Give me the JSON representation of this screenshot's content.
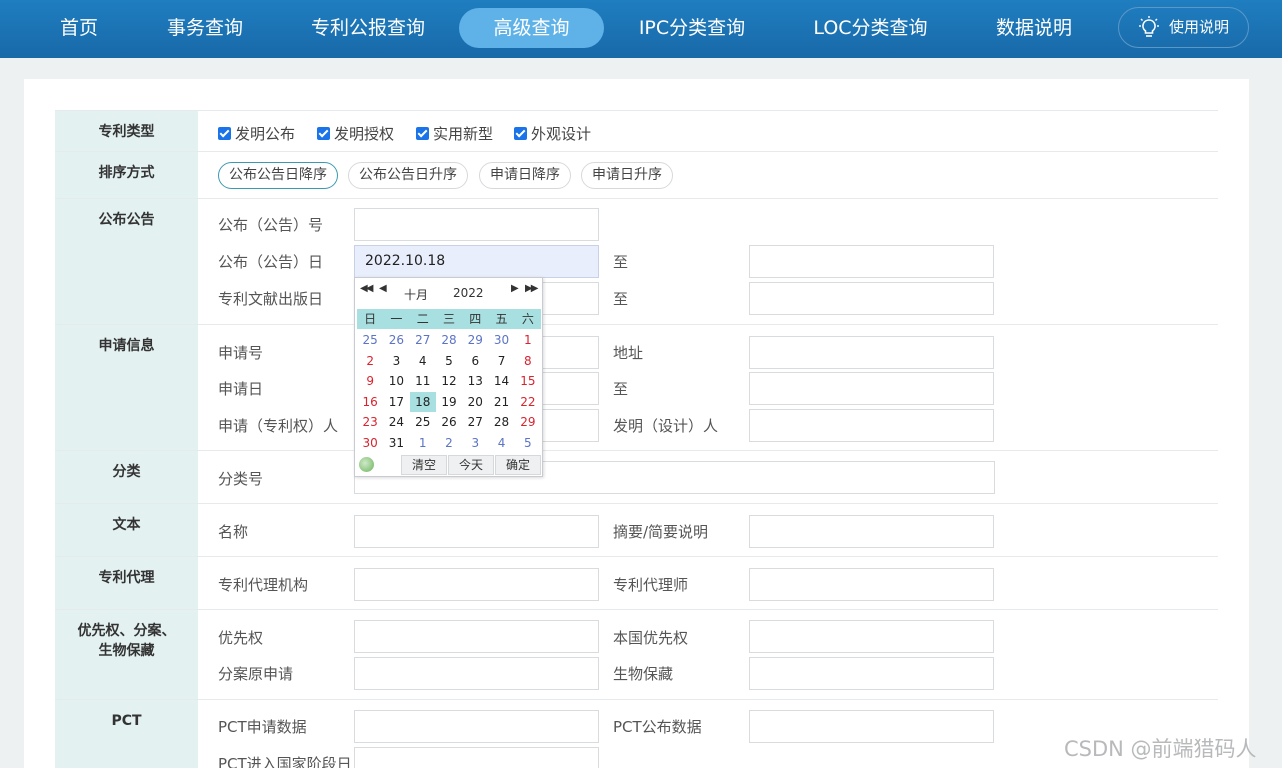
{
  "nav": {
    "items": [
      "首页",
      "事务查询",
      "专利公报查询",
      "高级查询",
      "IPC分类查询",
      "LOC分类查询",
      "数据说明"
    ],
    "active": "高级查询",
    "help": "使用说明"
  },
  "sections": {
    "type": {
      "label": "专利类型",
      "checkboxes": [
        "发明公布",
        "发明授权",
        "实用新型",
        "外观设计"
      ]
    },
    "sort": {
      "label": "排序方式",
      "options": [
        "公布公告日降序",
        "公布公告日升序",
        "申请日降序",
        "申请日升序"
      ],
      "selected": "公布公告日降序"
    },
    "publication": {
      "label": "公布公告",
      "pub_no": "公布（公告）号",
      "pub_date": "公布（公告）日",
      "pub_date_value": "2022.10.18",
      "to": "至",
      "doc_date": "专利文献出版日"
    },
    "application": {
      "label": "申请信息",
      "app_no": "申请号",
      "address": "地址",
      "app_date": "申请日",
      "to": "至",
      "applicant": "申请（专利权）人",
      "inventor": "发明（设计）人"
    },
    "classification": {
      "label": "分类",
      "class_no": "分类号"
    },
    "text": {
      "label": "文本",
      "name": "名称",
      "abstract": "摘要/简要说明"
    },
    "agency": {
      "label": "专利代理",
      "agency": "专利代理机构",
      "agent": "专利代理师"
    },
    "priority": {
      "label": "优先权、分案、生物保藏",
      "priority": "优先权",
      "domestic_priority": "本国优先权",
      "division": "分案原申请",
      "bio_deposit": "生物保藏"
    },
    "pct": {
      "label": "PCT",
      "pct_app": "PCT申请数据",
      "pct_pub": "PCT公布数据",
      "pct_entry": "PCT进入国家阶段日"
    }
  },
  "calendar": {
    "prev_year": "◀◀",
    "prev_month": "◀",
    "next_month": "▶",
    "next_year": "▶▶",
    "month": "十月",
    "year": "2022",
    "weekdays": [
      "日",
      "一",
      "二",
      "三",
      "四",
      "五",
      "六"
    ],
    "days": [
      "25",
      "26",
      "27",
      "28",
      "29",
      "30",
      "1",
      "2",
      "3",
      "4",
      "5",
      "6",
      "7",
      "8",
      "9",
      "10",
      "11",
      "12",
      "13",
      "14",
      "15",
      "16",
      "17",
      "18",
      "19",
      "20",
      "21",
      "22",
      "23",
      "24",
      "25",
      "26",
      "27",
      "28",
      "29",
      "30",
      "31",
      "1",
      "2",
      "3",
      "4",
      "5"
    ],
    "other_month_indexes": [
      0,
      1,
      2,
      3,
      4,
      5,
      37,
      38,
      39,
      40,
      41
    ],
    "selected_index": 23,
    "clear": "清空",
    "today": "今天",
    "ok": "确定"
  },
  "watermark": "CSDN @前端猎码人"
}
